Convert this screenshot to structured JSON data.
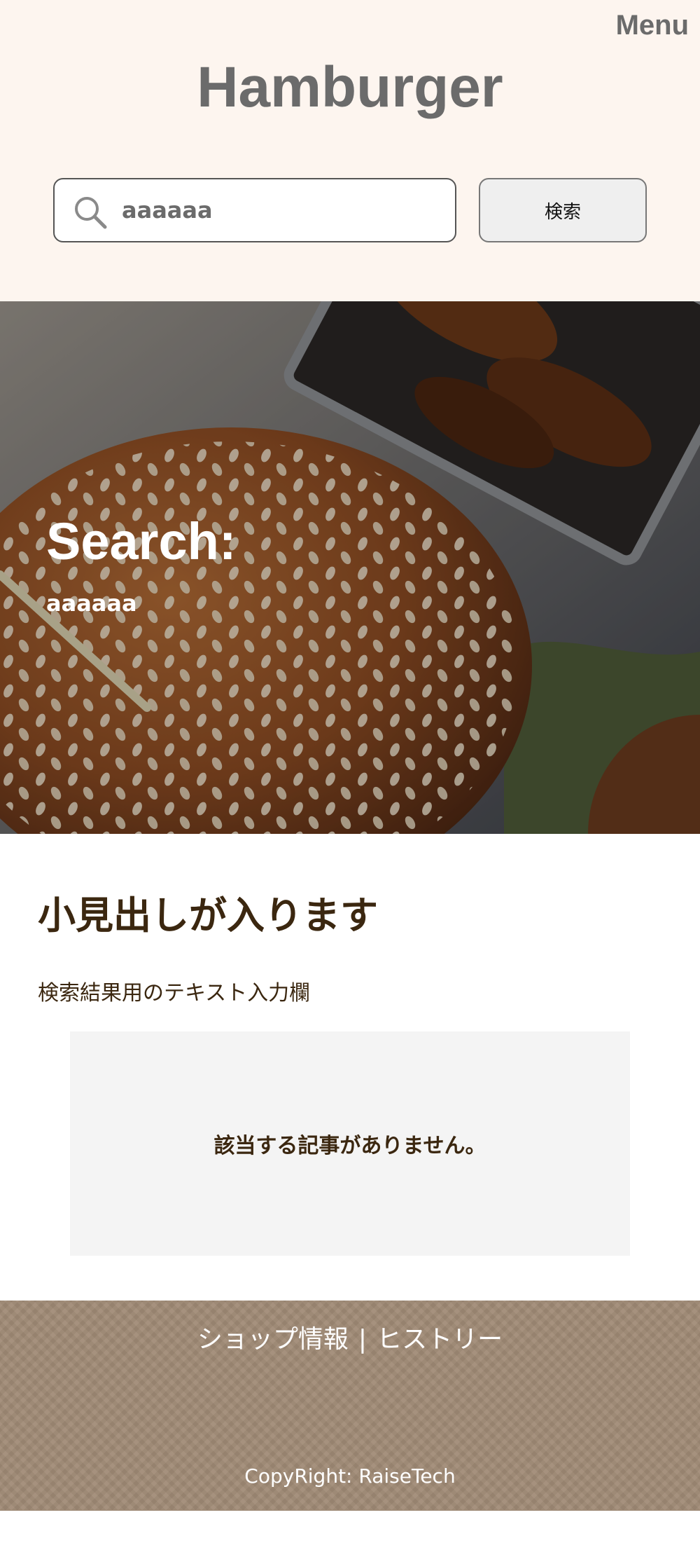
{
  "header": {
    "menu_label": "Menu",
    "logo": "Hamburger",
    "search": {
      "value": "aaaaaa",
      "button_label": "検索"
    }
  },
  "hero": {
    "title": "Search:",
    "term": "aaaaaa"
  },
  "main": {
    "heading": "小見出しが入ります",
    "description": "検索結果用のテキスト入力欄",
    "empty_message": "該当する記事がありません。"
  },
  "footer": {
    "nav": [
      {
        "label": "ショップ情報"
      },
      {
        "label": "ヒストリー"
      }
    ],
    "separator": "|",
    "copyright": "CopyRight: RaiseTech"
  },
  "colors": {
    "header_bg": "#fdf5ef",
    "text_brown": "#3b2710",
    "footer_bg": "#a08a76",
    "logo_gray": "#6b6b6b"
  }
}
